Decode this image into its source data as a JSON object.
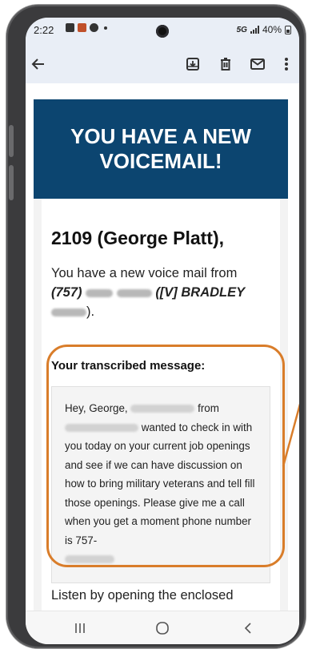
{
  "status_bar": {
    "time": "2:22",
    "network": "5G",
    "battery": "40%"
  },
  "toolbar": {
    "back": "back-arrow",
    "archive": "archive-icon",
    "delete": "trash-icon",
    "mark_unread": "mail-icon",
    "more": "more-vert-icon"
  },
  "email": {
    "banner": "YOU HAVE A NEW VOICEMAIL!",
    "recipient": "2109 (George Platt),",
    "intro_prefix": "You have a new voice mail from",
    "caller_area_code": "(757)",
    "caller_name_prefix": "([V] BRADLEY",
    "caller_close": ").",
    "transcribed_label": "Your transcribed message:",
    "transcript": {
      "part1": "Hey, George,",
      "part2": "from",
      "part3": "wanted to check in with you today on your current job openings and see if we can have discussion on how to bring military veterans and tell fill those openings. Please give me a call when you get a moment phone number is 757-"
    },
    "listen_text": "Listen by opening the enclosed"
  },
  "colors": {
    "banner_bg": "#0c4570",
    "highlight": "#d97d2a"
  },
  "navbar": {
    "recent": "recent-apps-icon",
    "home": "home-icon",
    "back": "back-nav-icon"
  }
}
